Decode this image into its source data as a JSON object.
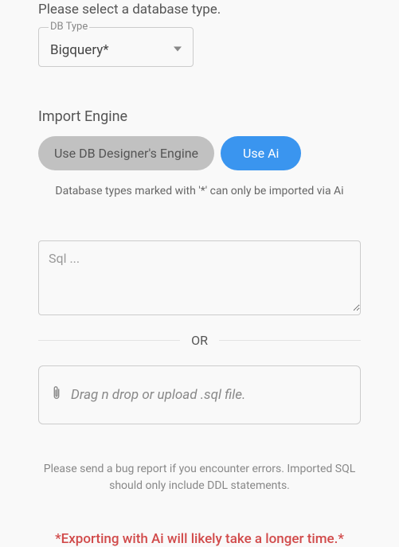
{
  "select_prompt": "Please select a database type.",
  "db_type": {
    "floating_label": "DB Type",
    "value": "Bigquery*"
  },
  "engine": {
    "title": "Import Engine",
    "buttons": {
      "db_designer": "Use DB Designer's Engine",
      "ai": "Use Ai"
    },
    "hint": "Database types marked with '*' can only be imported via Ai"
  },
  "sql_placeholder": "Sql ...",
  "or_label": "OR",
  "drop": {
    "text": "Drag n drop or upload .sql file."
  },
  "bug_text": "Please send a bug report if you encounter errors. Imported SQL should only include DDL statements.",
  "warn_text": "*Exporting with Ai will likely take a longer time.*"
}
